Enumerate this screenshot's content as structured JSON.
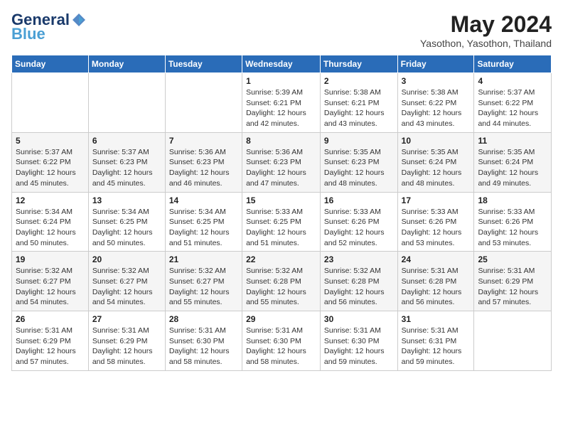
{
  "logo": {
    "line1": "General",
    "line2": "Blue",
    "icon": "▶"
  },
  "title": "May 2024",
  "subtitle": "Yasothon, Yasothon, Thailand",
  "days_of_week": [
    "Sunday",
    "Monday",
    "Tuesday",
    "Wednesday",
    "Thursday",
    "Friday",
    "Saturday"
  ],
  "weeks": [
    [
      {
        "day": "",
        "info": ""
      },
      {
        "day": "",
        "info": ""
      },
      {
        "day": "",
        "info": ""
      },
      {
        "day": "1",
        "info": "Sunrise: 5:39 AM\nSunset: 6:21 PM\nDaylight: 12 hours\nand 42 minutes."
      },
      {
        "day": "2",
        "info": "Sunrise: 5:38 AM\nSunset: 6:21 PM\nDaylight: 12 hours\nand 43 minutes."
      },
      {
        "day": "3",
        "info": "Sunrise: 5:38 AM\nSunset: 6:22 PM\nDaylight: 12 hours\nand 43 minutes."
      },
      {
        "day": "4",
        "info": "Sunrise: 5:37 AM\nSunset: 6:22 PM\nDaylight: 12 hours\nand 44 minutes."
      }
    ],
    [
      {
        "day": "5",
        "info": "Sunrise: 5:37 AM\nSunset: 6:22 PM\nDaylight: 12 hours\nand 45 minutes."
      },
      {
        "day": "6",
        "info": "Sunrise: 5:37 AM\nSunset: 6:23 PM\nDaylight: 12 hours\nand 45 minutes."
      },
      {
        "day": "7",
        "info": "Sunrise: 5:36 AM\nSunset: 6:23 PM\nDaylight: 12 hours\nand 46 minutes."
      },
      {
        "day": "8",
        "info": "Sunrise: 5:36 AM\nSunset: 6:23 PM\nDaylight: 12 hours\nand 47 minutes."
      },
      {
        "day": "9",
        "info": "Sunrise: 5:35 AM\nSunset: 6:23 PM\nDaylight: 12 hours\nand 48 minutes."
      },
      {
        "day": "10",
        "info": "Sunrise: 5:35 AM\nSunset: 6:24 PM\nDaylight: 12 hours\nand 48 minutes."
      },
      {
        "day": "11",
        "info": "Sunrise: 5:35 AM\nSunset: 6:24 PM\nDaylight: 12 hours\nand 49 minutes."
      }
    ],
    [
      {
        "day": "12",
        "info": "Sunrise: 5:34 AM\nSunset: 6:24 PM\nDaylight: 12 hours\nand 50 minutes."
      },
      {
        "day": "13",
        "info": "Sunrise: 5:34 AM\nSunset: 6:25 PM\nDaylight: 12 hours\nand 50 minutes."
      },
      {
        "day": "14",
        "info": "Sunrise: 5:34 AM\nSunset: 6:25 PM\nDaylight: 12 hours\nand 51 minutes."
      },
      {
        "day": "15",
        "info": "Sunrise: 5:33 AM\nSunset: 6:25 PM\nDaylight: 12 hours\nand 51 minutes."
      },
      {
        "day": "16",
        "info": "Sunrise: 5:33 AM\nSunset: 6:26 PM\nDaylight: 12 hours\nand 52 minutes."
      },
      {
        "day": "17",
        "info": "Sunrise: 5:33 AM\nSunset: 6:26 PM\nDaylight: 12 hours\nand 53 minutes."
      },
      {
        "day": "18",
        "info": "Sunrise: 5:33 AM\nSunset: 6:26 PM\nDaylight: 12 hours\nand 53 minutes."
      }
    ],
    [
      {
        "day": "19",
        "info": "Sunrise: 5:32 AM\nSunset: 6:27 PM\nDaylight: 12 hours\nand 54 minutes."
      },
      {
        "day": "20",
        "info": "Sunrise: 5:32 AM\nSunset: 6:27 PM\nDaylight: 12 hours\nand 54 minutes."
      },
      {
        "day": "21",
        "info": "Sunrise: 5:32 AM\nSunset: 6:27 PM\nDaylight: 12 hours\nand 55 minutes."
      },
      {
        "day": "22",
        "info": "Sunrise: 5:32 AM\nSunset: 6:28 PM\nDaylight: 12 hours\nand 55 minutes."
      },
      {
        "day": "23",
        "info": "Sunrise: 5:32 AM\nSunset: 6:28 PM\nDaylight: 12 hours\nand 56 minutes."
      },
      {
        "day": "24",
        "info": "Sunrise: 5:31 AM\nSunset: 6:28 PM\nDaylight: 12 hours\nand 56 minutes."
      },
      {
        "day": "25",
        "info": "Sunrise: 5:31 AM\nSunset: 6:29 PM\nDaylight: 12 hours\nand 57 minutes."
      }
    ],
    [
      {
        "day": "26",
        "info": "Sunrise: 5:31 AM\nSunset: 6:29 PM\nDaylight: 12 hours\nand 57 minutes."
      },
      {
        "day": "27",
        "info": "Sunrise: 5:31 AM\nSunset: 6:29 PM\nDaylight: 12 hours\nand 58 minutes."
      },
      {
        "day": "28",
        "info": "Sunrise: 5:31 AM\nSunset: 6:30 PM\nDaylight: 12 hours\nand 58 minutes."
      },
      {
        "day": "29",
        "info": "Sunrise: 5:31 AM\nSunset: 6:30 PM\nDaylight: 12 hours\nand 58 minutes."
      },
      {
        "day": "30",
        "info": "Sunrise: 5:31 AM\nSunset: 6:30 PM\nDaylight: 12 hours\nand 59 minutes."
      },
      {
        "day": "31",
        "info": "Sunrise: 5:31 AM\nSunset: 6:31 PM\nDaylight: 12 hours\nand 59 minutes."
      },
      {
        "day": "",
        "info": ""
      }
    ]
  ]
}
